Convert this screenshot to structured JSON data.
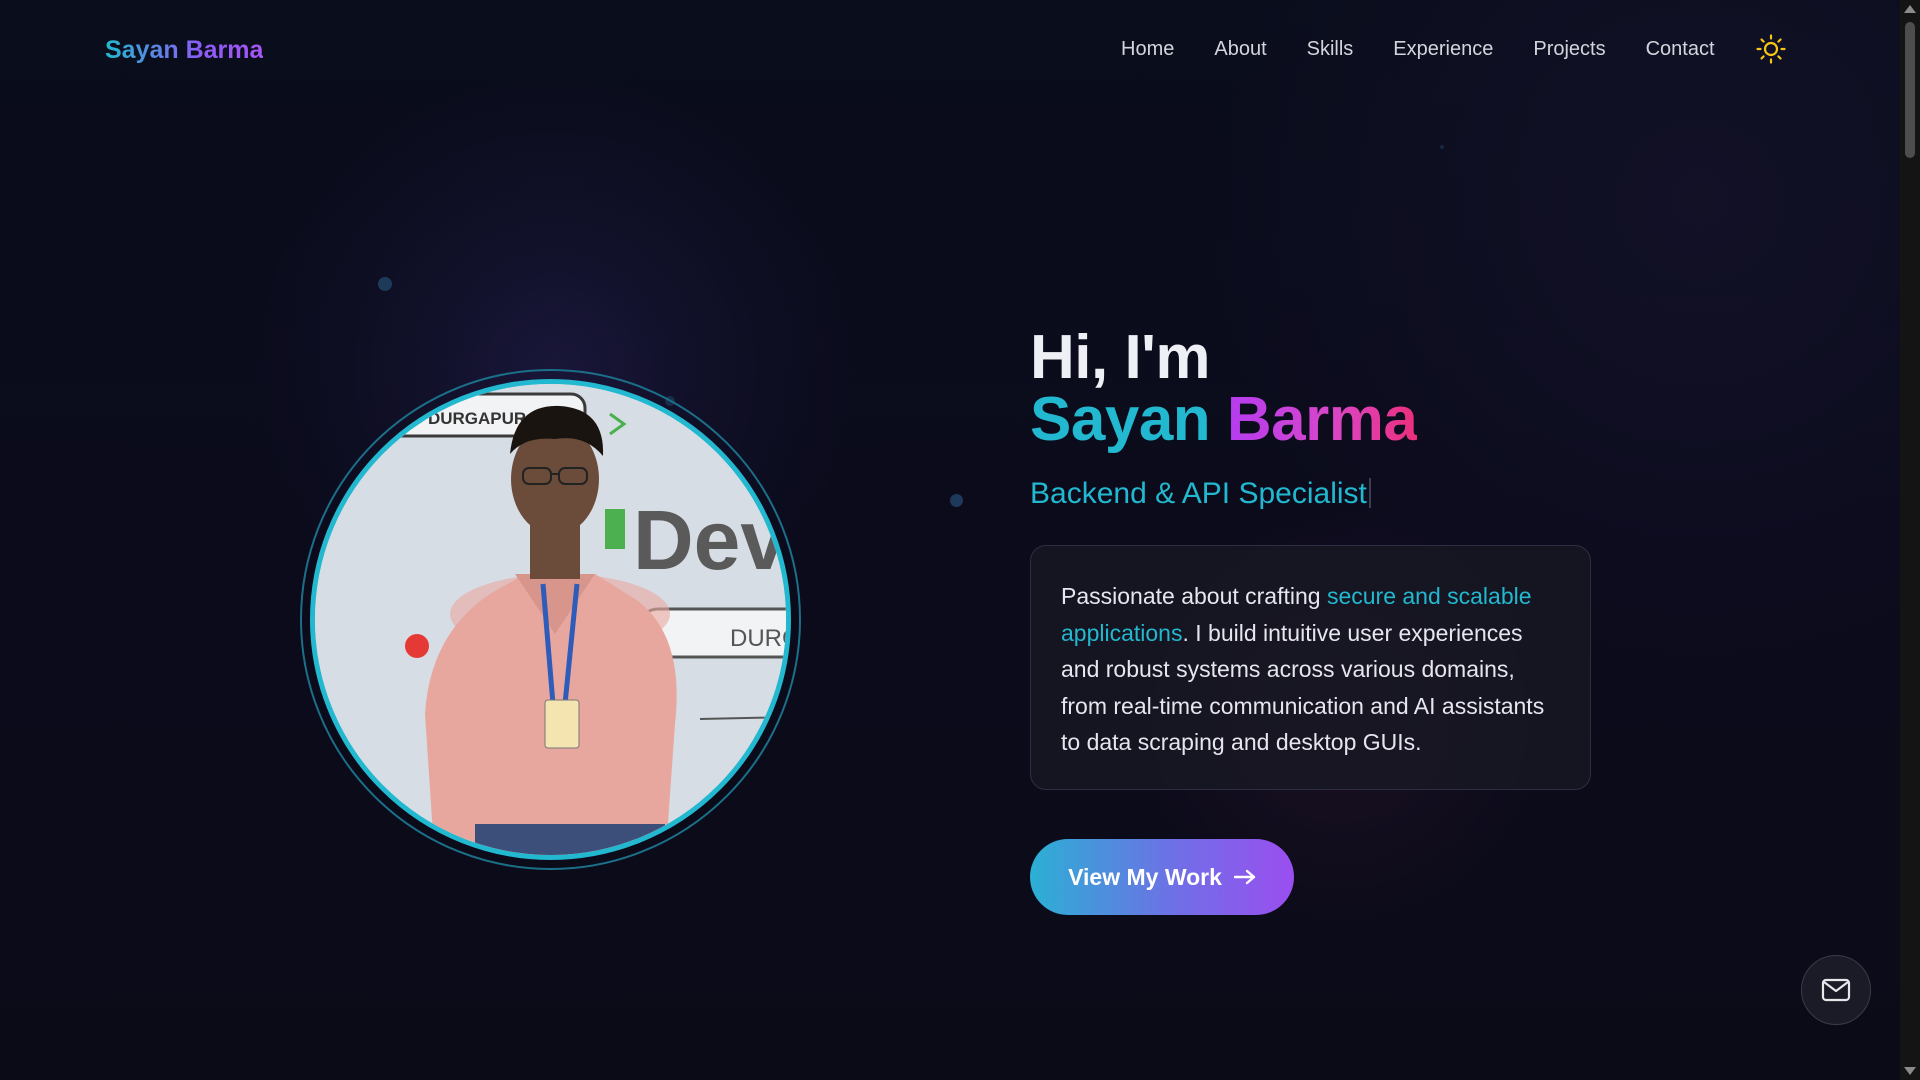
{
  "nav": {
    "brand": "Sayan Barma",
    "links": [
      "Home",
      "About",
      "Skills",
      "Experience",
      "Projects",
      "Contact"
    ],
    "theme_icon": "sun-icon"
  },
  "hero": {
    "greeting": "Hi, I'm",
    "name_first": "Sayan",
    "name_last": "Barma",
    "role": "Backend & API Specialist",
    "bio_prefix": "Passionate about crafting ",
    "bio_highlight": "secure and scalable applications",
    "bio_suffix": ". I build intuitive user experiences and robust systems across various domains, from real-time communication and AI assistants to data scraping and desktop GUIs.",
    "cta_label": "View My Work",
    "cta_icon": "arrow-right-icon",
    "photo_banner_text_1": "G DURGAPUR",
    "photo_banner_text_2": "Dev",
    "photo_banner_text_3": "DURG"
  },
  "floating": {
    "mail_icon": "mail-icon"
  },
  "colors": {
    "accent_cyan": "#22b8cf",
    "accent_purple": "#a855f7",
    "accent_pink": "#ec2f7b",
    "background": "#0b0b1a"
  }
}
